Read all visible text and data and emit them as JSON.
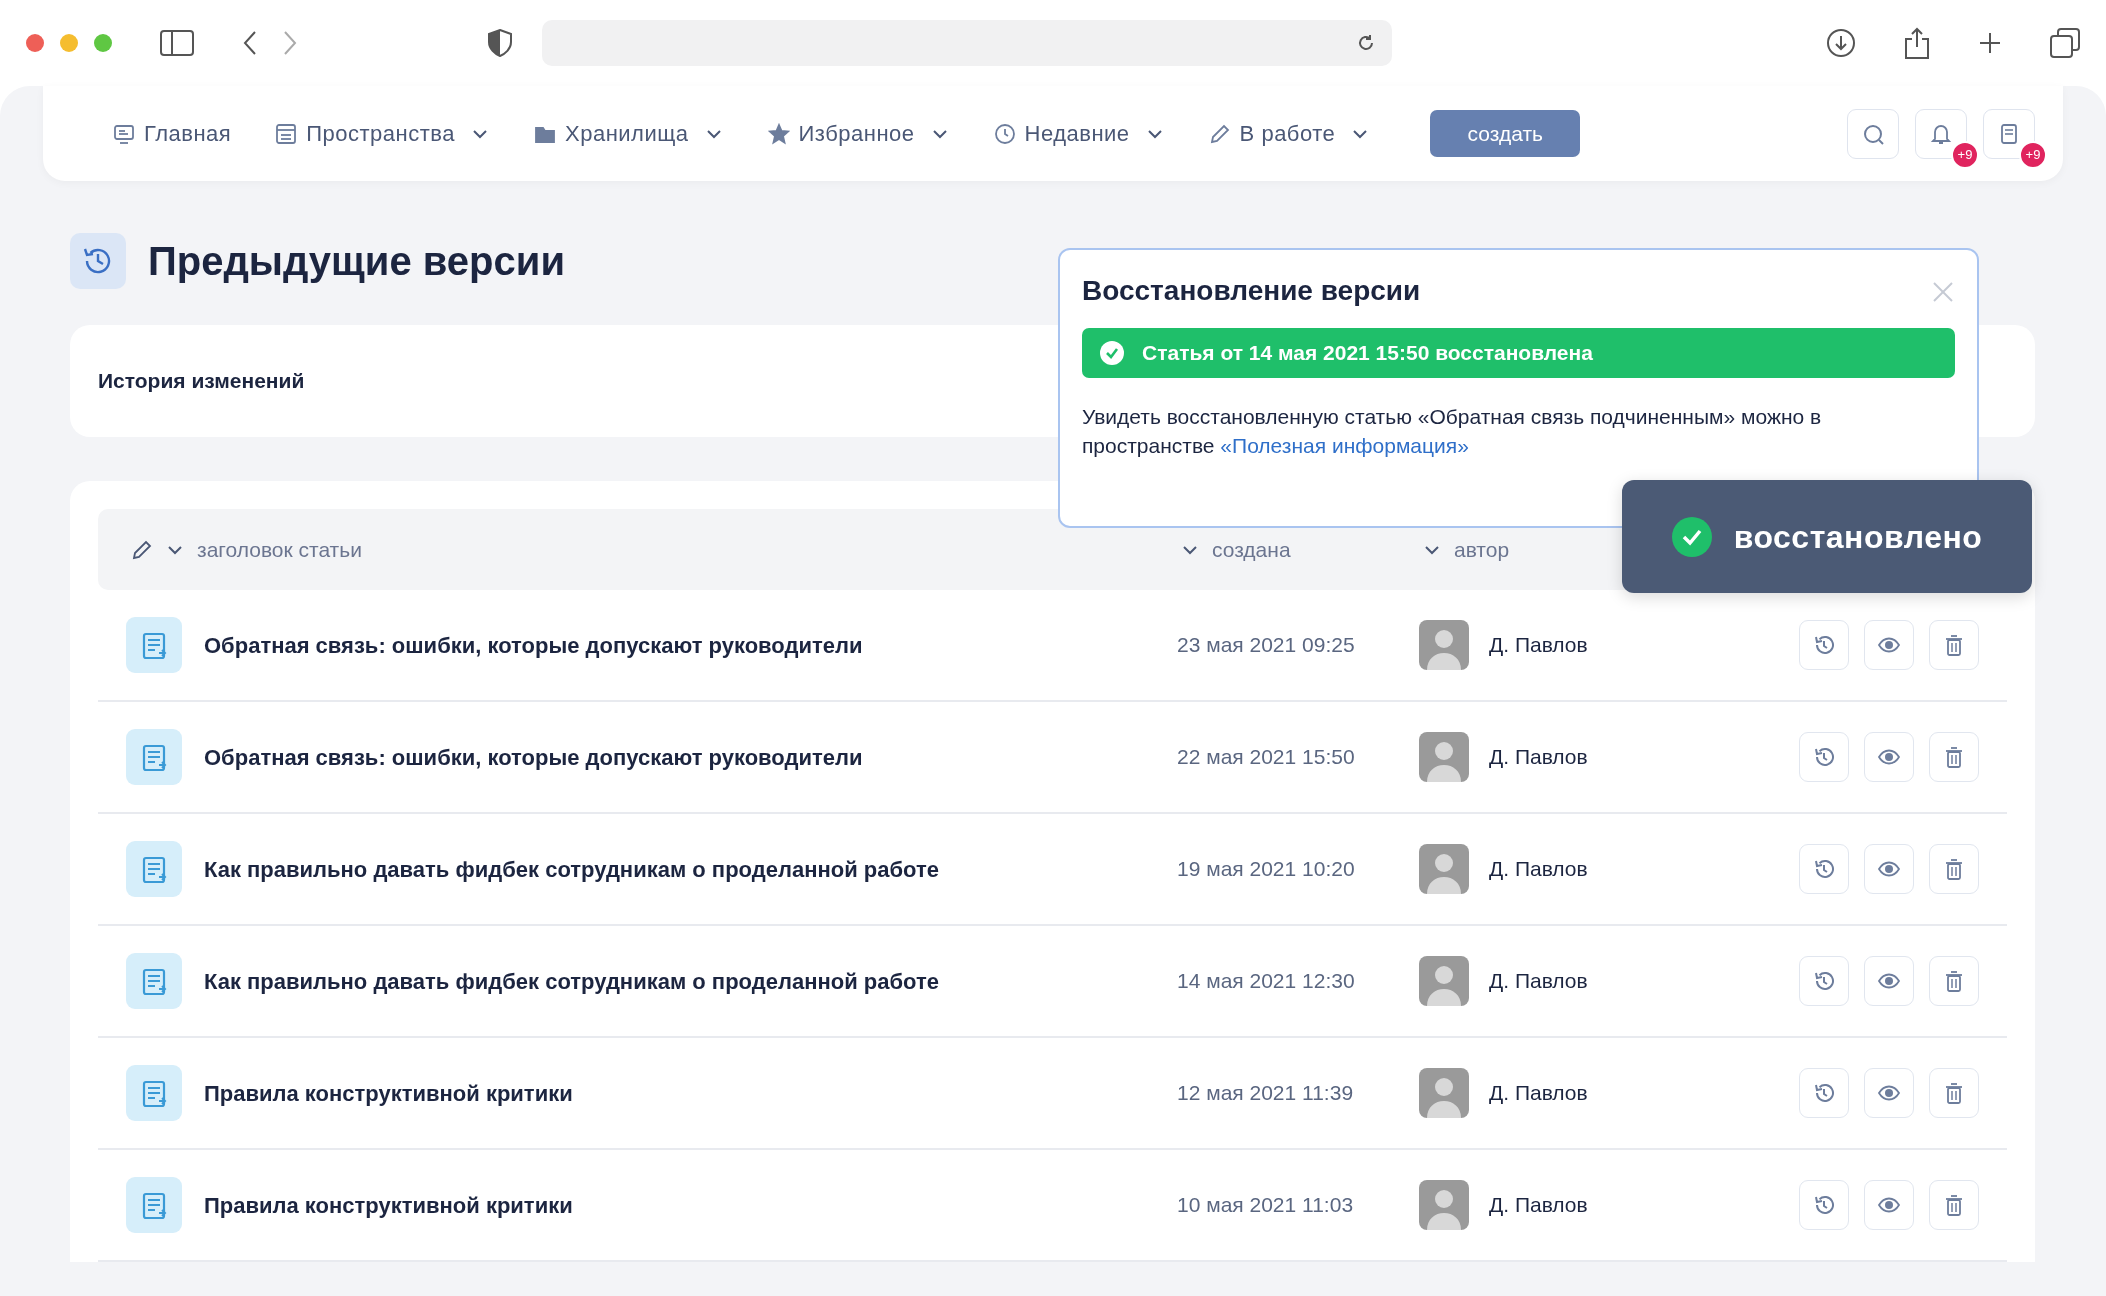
{
  "nav": {
    "items": [
      {
        "label": "Главная",
        "dropdown": false
      },
      {
        "label": "Пространства",
        "dropdown": true
      },
      {
        "label": "Хранилища",
        "dropdown": true
      },
      {
        "label": "Избранное",
        "dropdown": true
      },
      {
        "label": "Недавние",
        "dropdown": true
      },
      {
        "label": "В работе",
        "dropdown": true
      }
    ],
    "create_button": "создать",
    "icon_buttons": [
      {
        "kind": "search"
      },
      {
        "kind": "notifications",
        "badge": "+9"
      },
      {
        "kind": "documents",
        "badge": "+9"
      }
    ]
  },
  "page": {
    "title": "Предыдущие версии",
    "history_label": "История изменений"
  },
  "table": {
    "columns": [
      {
        "label": "заголовок статьи"
      },
      {
        "label": "создана"
      },
      {
        "label": "автор"
      }
    ],
    "rows": [
      {
        "title": "Обратная связь: ошибки, которые допускают руководители",
        "date": "23 мая 2021 09:25",
        "author": "Д. Павлов"
      },
      {
        "title": "Обратная связь: ошибки, которые допускают руководители",
        "date": "22 мая 2021 15:50",
        "author": "Д. Павлов"
      },
      {
        "title": "Как правильно давать фидбек сотрудникам о проделанной работе",
        "date": "19 мая 2021 10:20",
        "author": "Д. Павлов"
      },
      {
        "title": "Как правильно давать фидбек сотрудникам о проделанной работе",
        "date": "14 мая 2021 12:30",
        "author": "Д. Павлов"
      },
      {
        "title": "Правила конструктивной критики",
        "date": "12 мая 2021 11:39",
        "author": "Д. Павлов"
      },
      {
        "title": "Правила конструктивной критики",
        "date": "10 мая 2021 11:03",
        "author": "Д. Павлов"
      }
    ]
  },
  "dialog": {
    "title": "Восстановление версии",
    "alert": "Статья от 14 мая 2021 15:50 восстановлена",
    "text": "Увидеть восстановленную статью «Обратная связь подчиненным» можно в пространстве ",
    "link": "«Полезная информация»"
  },
  "toast": {
    "text": "восстановлено"
  }
}
